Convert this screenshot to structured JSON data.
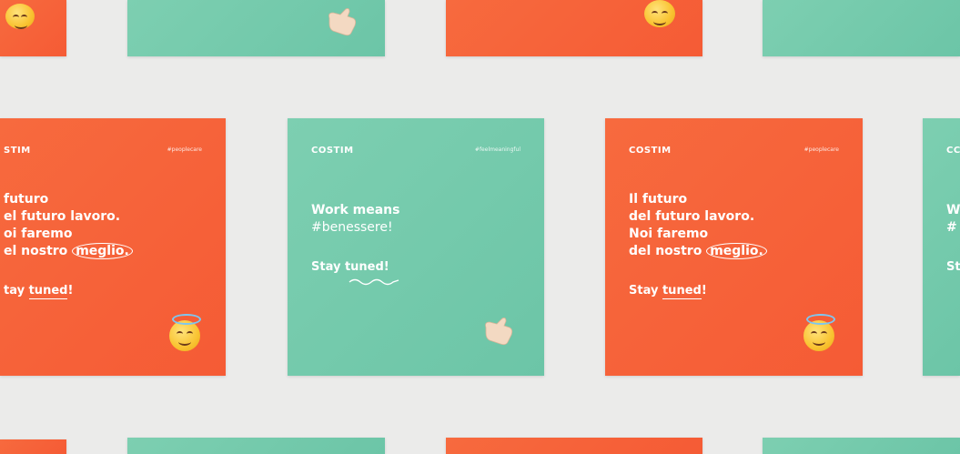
{
  "brand": "COSTIM",
  "tags": {
    "people_tag": "#peoplecare",
    "wellbeing_tag": "#feelmeaningful"
  },
  "orange_post": {
    "headline_lines": [
      "Il futuro",
      "del futuro lavoro.",
      "Noi faremo",
      "del nostro"
    ],
    "highlight_word": "meglio.",
    "cta_prefix": "Stay",
    "cta_underlined": "tuned",
    "cta_suffix": "!"
  },
  "orange_post_cropped": {
    "brand_visible": "STIM",
    "headline_lines": [
      "futuro",
      "el futuro lavoro.",
      "oi faremo",
      "el nostro"
    ],
    "highlight_word": "meglio.",
    "cta_prefix": "tay",
    "cta_underlined": "tuned",
    "cta_suffix": "!"
  },
  "green_post": {
    "headline_lines": [
      "Work means",
      "#benessere!"
    ],
    "cta_prefix": "Stay tuned",
    "cta_suffix": "!"
  },
  "green_post_cropped": {
    "brand_visible": "CC",
    "lines": [
      "W",
      "#",
      "St"
    ]
  },
  "colors": {
    "orange": "#f55b35",
    "green": "#6cc5a7",
    "background": "#ebebea"
  },
  "icons": [
    "smiling-face-with-halo-icon",
    "call-me-hand-icon"
  ]
}
